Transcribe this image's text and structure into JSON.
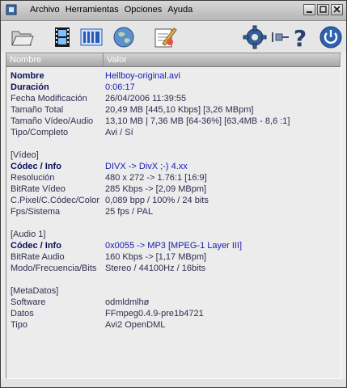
{
  "menu": [
    "Archivo",
    "Herramientas",
    "Opciones",
    "Ayuda"
  ],
  "toolbar": {
    "icons": [
      "open-folder-icon",
      "film-icon",
      "info-grid-icon",
      "globe-icon",
      "edit-notes-icon",
      "settings-gear-icon",
      "pin-icon",
      "help-icon",
      "power-icon"
    ]
  },
  "list": {
    "headers": [
      "Nombre",
      "Valor"
    ],
    "rows": [
      {
        "k": "Nombre",
        "v": "Hellboy-original.avi",
        "style": "b"
      },
      {
        "k": "Duración",
        "v": "0:06:17",
        "style": "b"
      },
      {
        "k": "Fecha Modificación",
        "v": "26/04/2006 11:39:55",
        "style": ""
      },
      {
        "k": "Tamaño Total",
        "v": "20,49 MB  [445,10 Kbps]  [3,26 MBpm]",
        "style": ""
      },
      {
        "k": "Tamaño Vídeo/Audio",
        "v": "13,10 MB | 7,36 MB  [64-36%]  [63,4MB - 8,6 :1]",
        "style": ""
      },
      {
        "k": "Tipo/Completo",
        "v": "Avi / Sí",
        "style": ""
      },
      {
        "k": "",
        "v": "",
        "style": ""
      },
      {
        "k": "[Vídeo]",
        "v": "",
        "style": "s"
      },
      {
        "k": "Códec / Info",
        "v": "DIVX  ->  DivX ;-) 4.xx",
        "style": "b"
      },
      {
        "k": "Resolución",
        "v": "480 x 272  ->  1.76:1 [16:9]",
        "style": ""
      },
      {
        "k": "BitRate Vídeo",
        "v": "285 Kbps  ->  [2,09 MBpm]",
        "style": ""
      },
      {
        "k": "C.Pixel/C.Códec/Color",
        "v": "0,089 bpp / 100% / 24 bits",
        "style": ""
      },
      {
        "k": "Fps/Sistema",
        "v": "25 fps / PAL",
        "style": ""
      },
      {
        "k": "",
        "v": "",
        "style": ""
      },
      {
        "k": "[Audio 1]",
        "v": "",
        "style": "s"
      },
      {
        "k": "Códec / Info",
        "v": "0x0055  ->  MP3 [MPEG-1 Layer III]",
        "style": "b"
      },
      {
        "k": "BitRate Audio",
        "v": "160 Kbps  ->  [1,17 MBpm]",
        "style": ""
      },
      {
        "k": "Modo/Frecuencia/Bits",
        "v": "Stereo / 44100Hz / 16bits",
        "style": ""
      },
      {
        "k": "",
        "v": "",
        "style": ""
      },
      {
        "k": "[MetaDatos]",
        "v": "",
        "style": "s"
      },
      {
        "k": "Software",
        "v": "odmldmlhø",
        "style": ""
      },
      {
        "k": "Datos",
        "v": "FFmpeg0.4.9-pre1b4721",
        "style": ""
      },
      {
        "k": "Tipo",
        "v": "Avi2 OpenDML",
        "style": ""
      }
    ]
  }
}
